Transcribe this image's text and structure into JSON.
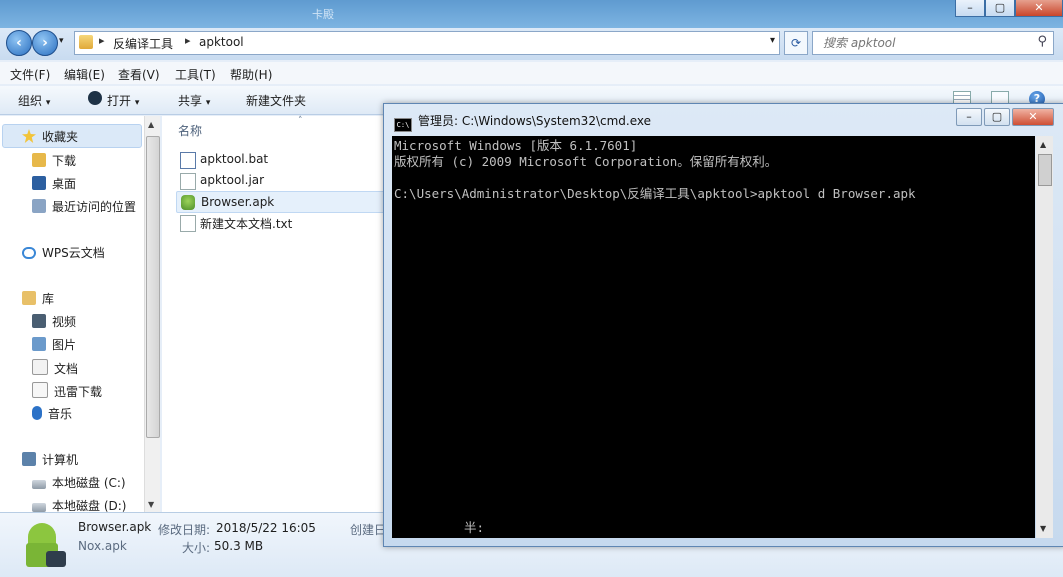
{
  "window": {
    "title_ghost": "卡殿",
    "min": "–",
    "max": "▢",
    "close": "✕"
  },
  "address": {
    "segments": [
      "反编译工具",
      "apktool"
    ],
    "search_placeholder": "搜索 apktool"
  },
  "menu": [
    "文件(F)",
    "编辑(E)",
    "查看(V)",
    "工具(T)",
    "帮助(H)"
  ],
  "toolbar": {
    "organize": "组织",
    "open": "打开",
    "share": "共享",
    "new_folder": "新建文件夹",
    "help": "?"
  },
  "navpane": {
    "favorites": "收藏夹",
    "downloads": "下载",
    "desktop": "桌面",
    "recent": "最近访问的位置",
    "wps": "WPS云文档",
    "libraries": "库",
    "videos": "视频",
    "pictures": "图片",
    "documents": "文档",
    "thunder": "迅雷下载",
    "music": "音乐",
    "computer": "计算机",
    "disk_c": "本地磁盘 (C:)",
    "disk_d": "本地磁盘 (D:)"
  },
  "filelist": {
    "column_name": "名称",
    "files": [
      "apktool.bat",
      "apktool.jar",
      "Browser.apk",
      "新建文本文档.txt"
    ]
  },
  "details": {
    "filename": "Browser.apk",
    "modified_label": "修改日期:",
    "modified_value": "2018/5/22 16:05",
    "created_label": "创建日",
    "app": "Nox.apk",
    "size_label": "大小:",
    "size_value": "50.3 MB"
  },
  "cmd": {
    "title": "管理员: C:\\Windows\\System32\\cmd.exe",
    "icon_text": "C:\\",
    "lines": [
      "Microsoft Windows [版本 6.1.7601]",
      "版权所有 (c) 2009 Microsoft Corporation。保留所有权利。",
      "",
      "C:\\Users\\Administrator\\Desktop\\反编译工具\\apktool>apktool d Browser.apk"
    ],
    "ime_status": "半:"
  }
}
